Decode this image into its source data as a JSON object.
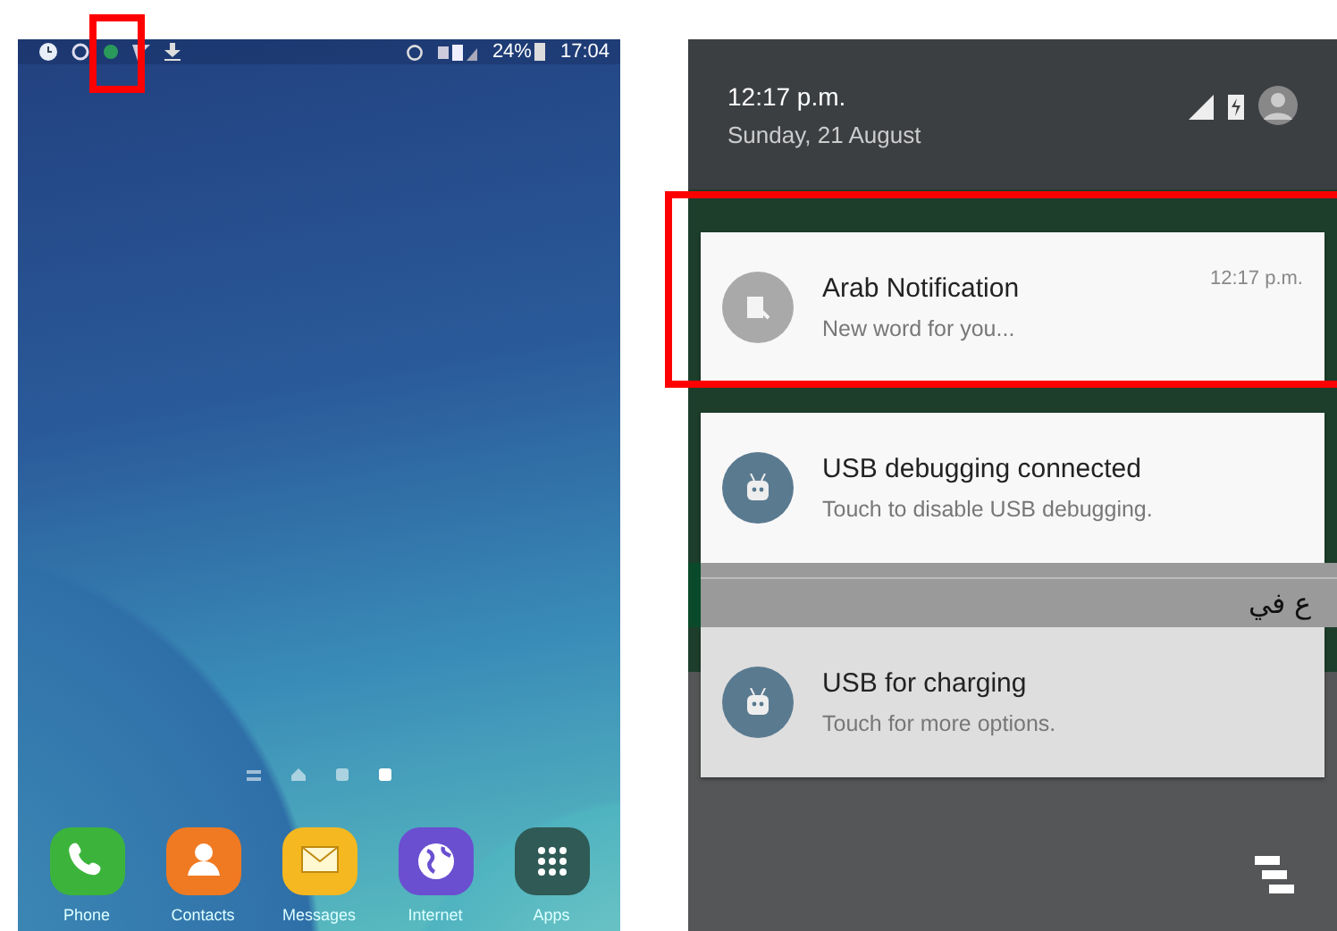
{
  "home_screen": {
    "status_bar": {
      "battery": "24%",
      "time": "17:04"
    },
    "page_indicators": [
      {
        "kind": "menu",
        "selected": false
      },
      {
        "kind": "home",
        "selected": false
      },
      {
        "kind": "dot",
        "selected": false
      },
      {
        "kind": "dot",
        "selected": true
      }
    ],
    "dock": [
      {
        "label": "Phone",
        "kind": "phone",
        "color": "#3cb43c"
      },
      {
        "label": "Contacts",
        "kind": "contact",
        "color": "#f07a22"
      },
      {
        "label": "Messages",
        "kind": "mail",
        "color": "#f5b820"
      },
      {
        "label": "Internet",
        "kind": "globe",
        "color": "#6a4fd0"
      },
      {
        "label": "Apps",
        "kind": "grid",
        "color": "#2f5a55"
      }
    ]
  },
  "notification_shade": {
    "time": "12:17 p.m.",
    "date": "Sunday, 21 August",
    "background_text": "ع في",
    "notifications": [
      {
        "kind": "app",
        "title": "Arab Notification",
        "text": "New word for you...",
        "time": "12:17 p.m.",
        "selected": false
      },
      {
        "kind": "android",
        "title": "USB debugging connected",
        "text": "Touch to disable USB debugging.",
        "selected": false
      },
      {
        "kind": "android",
        "title": "USB for charging",
        "text": "Touch for more options.",
        "selected": true
      }
    ]
  }
}
